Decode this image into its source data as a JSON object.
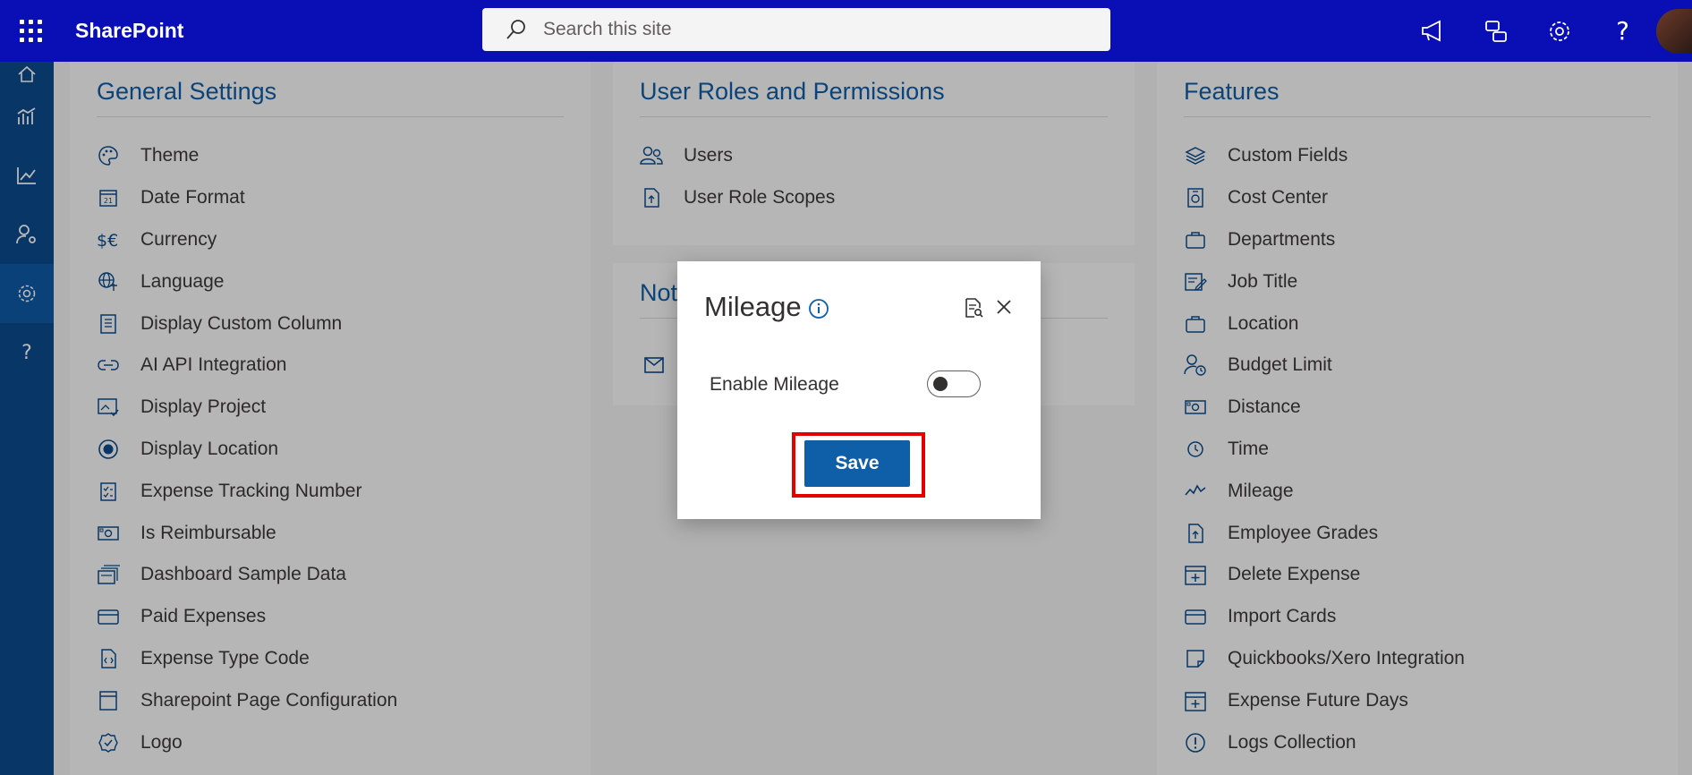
{
  "app": {
    "brand": "SharePoint"
  },
  "search": {
    "placeholder": "Search this site"
  },
  "topbar_icons": [
    "megaphone-icon",
    "chat-icon",
    "gear-icon",
    "help-icon"
  ],
  "rail_icons": [
    "home-icon",
    "analytics-icon",
    "trend-icon",
    "user-settings-icon",
    "gear-icon",
    "help-icon"
  ],
  "panels": {
    "general": {
      "title": "General Settings",
      "items": [
        "Theme",
        "Date Format",
        "Currency",
        "Language",
        "Display Custom Column",
        "AI API Integration",
        "Display Project",
        "Display Location",
        "Expense Tracking Number",
        "Is Reimbursable",
        "Dashboard Sample Data",
        "Paid Expenses",
        "Expense Type Code",
        "Sharepoint Page Configuration",
        "Logo"
      ]
    },
    "roles": {
      "title": "User Roles and Permissions",
      "items": [
        "Users",
        "User Role Scopes"
      ]
    },
    "notifications": {
      "title_partial": "Not"
    },
    "features": {
      "title": "Features",
      "items": [
        "Custom Fields",
        "Cost Center",
        "Departments",
        "Job Title",
        "Location",
        "Budget Limit",
        "Distance",
        "Time",
        "Mileage",
        "Employee Grades",
        "Delete Expense",
        "Import Cards",
        "Quickbooks/Xero Integration",
        "Expense Future Days",
        "Logs Collection"
      ]
    }
  },
  "dialog": {
    "title": "Mileage",
    "toggle_label": "Enable Mileage",
    "toggle_on": false,
    "save_label": "Save"
  },
  "colors": {
    "topbar": "#0a0fb5",
    "rail": "#0b4a8c",
    "accent": "#0f5ea8",
    "highlight": "#e30000"
  }
}
